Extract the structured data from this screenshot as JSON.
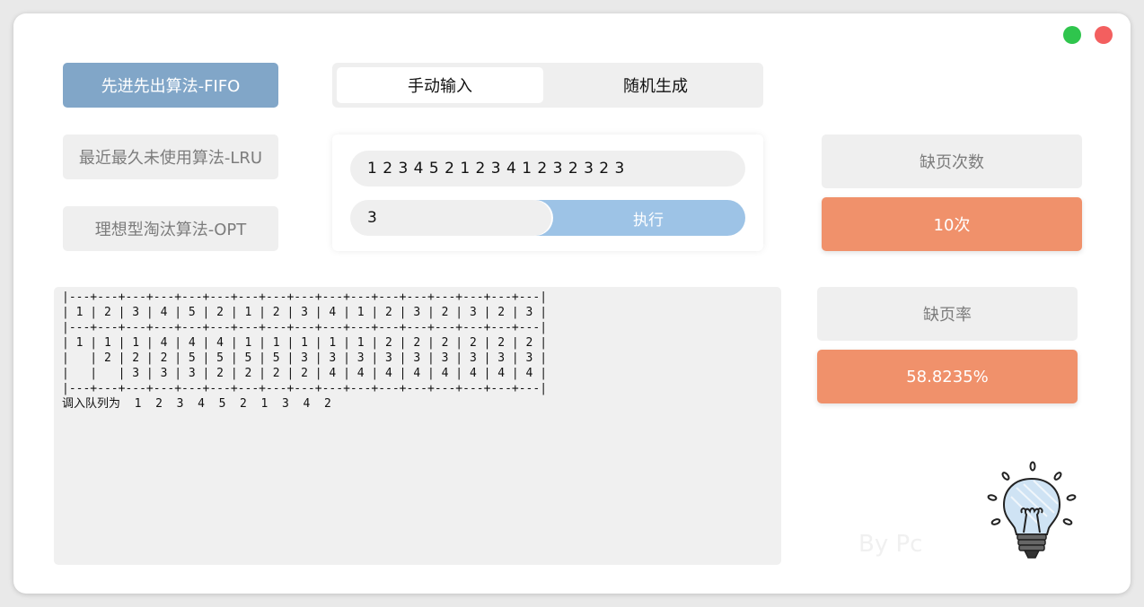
{
  "window": {
    "controls": [
      {
        "name": "maximize-control",
        "color": "#2fc54d"
      },
      {
        "name": "close-control",
        "color": "#f35f5f"
      }
    ]
  },
  "algorithms": {
    "fifo": "先进先出算法-FIFO",
    "lru": "最近最久未使用算法-LRU",
    "opt": "理想型淘汰算法-OPT",
    "active": "fifo"
  },
  "input_mode": {
    "tabs": [
      "手动输入",
      "随机生成"
    ],
    "selected": 0
  },
  "input": {
    "sequence": "1 2 3 4 5 2 1 2 3 4 1 2 3 2 3 2 3",
    "frames": "3",
    "execute_label": "执行"
  },
  "stats": {
    "fault_count_label": "缺页次数",
    "fault_count_value": "10次",
    "fault_rate_label": "缺页率",
    "fault_rate_value": "58.8235%"
  },
  "output": {
    "text": "|---+---+---+---+---+---+---+---+---+---+---+---+---+---+---+---+---|\n| 1 | 2 | 3 | 4 | 5 | 2 | 1 | 2 | 3 | 4 | 1 | 2 | 3 | 2 | 3 | 2 | 3 |\n|---+---+---+---+---+---+---+---+---+---+---+---+---+---+---+---+---|\n| 1 | 1 | 1 | 4 | 4 | 4 | 1 | 1 | 1 | 1 | 1 | 2 | 2 | 2 | 2 | 2 | 2 |\n|   | 2 | 2 | 2 | 5 | 5 | 5 | 5 | 3 | 3 | 3 | 3 | 3 | 3 | 3 | 3 | 3 |\n|   |   | 3 | 3 | 3 | 2 | 2 | 2 | 2 | 4 | 4 | 4 | 4 | 4 | 4 | 4 | 4 |\n|---+---+---+---+---+---+---+---+---+---+---+---+---+---+---+---+---|\n调入队列为  1  2  3  4  5  2  1  3  4  2"
  },
  "watermark": "By Pc",
  "colors": {
    "accent_blue": "#81a6c8",
    "execute_blue": "#9dc3e6",
    "stat_orange": "#f0916b",
    "panel_gray": "#efefef"
  },
  "icons": {
    "idea": "lightbulb-icon"
  }
}
